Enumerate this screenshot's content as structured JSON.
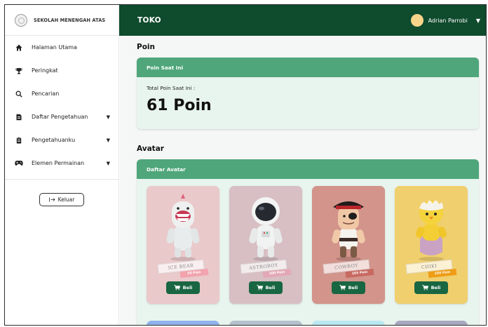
{
  "sidebar": {
    "brand": "SEKOLAH MENENGAH ATAS",
    "items": [
      {
        "label": "Halaman Utama",
        "icon": "home-icon"
      },
      {
        "label": "Peringkat",
        "icon": "trophy-icon"
      },
      {
        "label": "Pencarian",
        "icon": "search-icon"
      },
      {
        "label": "Daftar Pengetahuan",
        "icon": "book-icon",
        "caret": "▼"
      },
      {
        "label": "Pengetahuanku",
        "icon": "clipboard-icon",
        "caret": "▼"
      },
      {
        "label": "Elemen Permainan",
        "icon": "gamepad-icon",
        "caret": "▼"
      }
    ],
    "logout_label": "Keluar"
  },
  "header": {
    "title": "TOKO",
    "user_name": "Adrian Parrobi",
    "user_caret": "▼"
  },
  "main": {
    "poin": {
      "section_title": "Poin",
      "card_title": "Poin Saat Ini",
      "label": "Total Poin Saat Ini :",
      "value": "61 Poin"
    },
    "avatar": {
      "section_title": "Avatar",
      "card_title": "Daftar Avatar",
      "buy_label": "Beli",
      "items": [
        {
          "name": "ICE BEAR",
          "price": "50 Poin",
          "bg": "#eac9cb",
          "price_color": "#f2a3ad"
        },
        {
          "name": "ASTROBOY",
          "price": "100 Poin",
          "bg": "#d7bfc3",
          "price_color": "#e3a8b6"
        },
        {
          "name": "COWBOY",
          "price": "185 Poin",
          "bg": "#d2948b",
          "price_color": "#c86a62"
        },
        {
          "name": "CHIKI",
          "price": "250 Poin",
          "bg": "#f0cf6f",
          "price_color": "#ef9d16"
        }
      ],
      "next_row_colors": [
        "#8fb2ec",
        "#b3c1cc",
        "#b9e8f1",
        "#a9a8c0"
      ]
    }
  },
  "colors": {
    "topbar": "#0f4b2d",
    "card_header": "#4fa67a",
    "card_body": "#e8f4ee",
    "button": "#186642"
  }
}
